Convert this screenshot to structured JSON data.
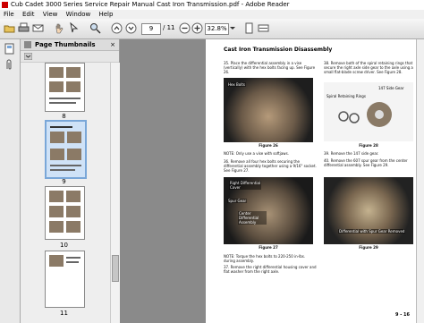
{
  "window": {
    "title": "Cub Cadet 3000 Series Service Repair Manual Cast Iron Transmission.pdf - Adobe Reader"
  },
  "menu": [
    "File",
    "Edit",
    "View",
    "Window",
    "Help"
  ],
  "toolbar": {
    "page_current": "9",
    "page_total": "/ 11",
    "zoom": "32.8%"
  },
  "panel": {
    "title": "Page Thumbnails",
    "close": "×",
    "thumbnails": [
      {
        "label": "8"
      },
      {
        "label": "9"
      },
      {
        "label": "10"
      },
      {
        "label": "11"
      }
    ]
  },
  "document": {
    "heading": "Cast Iron Transmission Disassembly",
    "steps_left": [
      {
        "num": "35.",
        "text": "Place the differential assembly in a vise (vertically) with the hex bolts facing up. See Figure 26."
      },
      {
        "num": "",
        "text": "NOTE: Only use a vise with softjaws."
      },
      {
        "num": "36.",
        "text": "Remove all four hex bolts securing the differential assembly together using a 9/16\" socket. See Figure 27."
      },
      {
        "num": "",
        "text": "NOTE: Torque the hex bolts to 220-250 in-lbs. during assembly."
      },
      {
        "num": "37.",
        "text": "Remove the right differential housing cover and flat washer from the right axle."
      }
    ],
    "steps_right": [
      {
        "num": "38.",
        "text": "Remove both of the spiral retaining rings that secure the right axle side gear to the axle using a small flat-blade screw driver. See Figure 28."
      },
      {
        "num": "39.",
        "text": "Remove the 147 side gear."
      },
      {
        "num": "40.",
        "text": "Remove the 607 spur gear from the center differential assembly. See Figure 29."
      }
    ],
    "figures": [
      {
        "caption": "Figure 26",
        "labels": [
          "Hex Bolts"
        ]
      },
      {
        "caption": "Figure 28",
        "labels": [
          "Spiral Retaining Rings",
          "147 Side Gear"
        ]
      },
      {
        "caption": "Figure 27",
        "labels": [
          "Right Differential Cover",
          "Spur Gear",
          "Center Differential Assembly"
        ]
      },
      {
        "caption": "Figure 29",
        "labels": [
          "Differential with Spur Gear Removed"
        ]
      }
    ],
    "footer": "9 - 16"
  }
}
